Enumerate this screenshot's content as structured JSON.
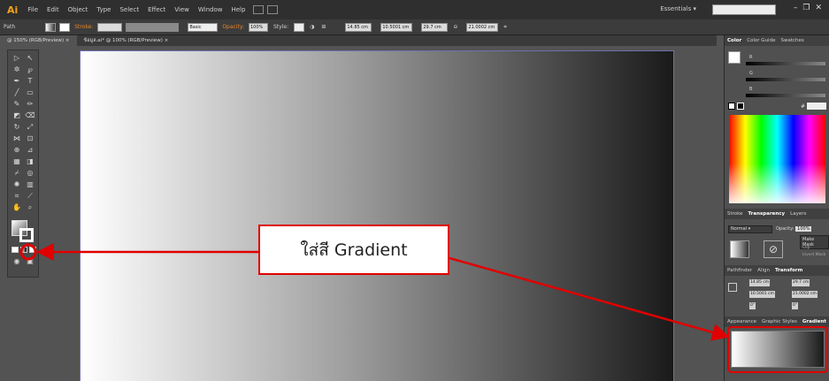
{
  "menubar": {
    "logo": "Ai",
    "items": [
      "File",
      "Edit",
      "Object",
      "Type",
      "Select",
      "Effect",
      "View",
      "Window",
      "Help"
    ],
    "essentials": "Essentials ▾"
  },
  "controlbar": {
    "path": "Path",
    "stroke": "Stroke:",
    "basic": "Basic",
    "opacity_label": "Opacity:",
    "opacity_value": "100%",
    "style": "Style:",
    "x_value": "14.85 cm",
    "y_value": "10.5001 cm",
    "w_value": "29.7 cm",
    "h_value": "21.0002 cm"
  },
  "doctabs": {
    "tab1": "@ 150% (RGB/Preview)",
    "tab2": "ข้อมูล.ai* @ 100% (RGB/Preview)"
  },
  "callout": {
    "text": "ใส่สี Gradient"
  },
  "panels": {
    "color_tabs": [
      "Color",
      "Color Guide",
      "Swatches"
    ],
    "color_active": "Color",
    "rgb_letters": [
      "R",
      "G",
      "B"
    ],
    "hex_symbol": "#",
    "transparency_tabs": [
      "Stroke",
      "Transparency",
      "Layers"
    ],
    "transparency_active": "Transparency",
    "blend_mode": "Normal",
    "opacity_label": "Opacity:",
    "opacity_value": "100%",
    "make_mask": "Make Mask",
    "clip": "Clip",
    "invert_mask": "Invert Mask",
    "transform_tabs": [
      "Pathfinder",
      "Align",
      "Transform"
    ],
    "transform_active": "Transform",
    "tx": "14.85 cm",
    "ty": "10.5001 cm",
    "tw": "29.7 cm",
    "th": "21.0002 cm",
    "tangle": "0°",
    "tshear": "0°",
    "appearance_tabs": [
      "Appearance",
      "Graphic Styles",
      "Gradient"
    ],
    "appearance_active": "Gradient"
  },
  "colors": {
    "highlight": "#e00000",
    "accent": "#f7a21b"
  }
}
